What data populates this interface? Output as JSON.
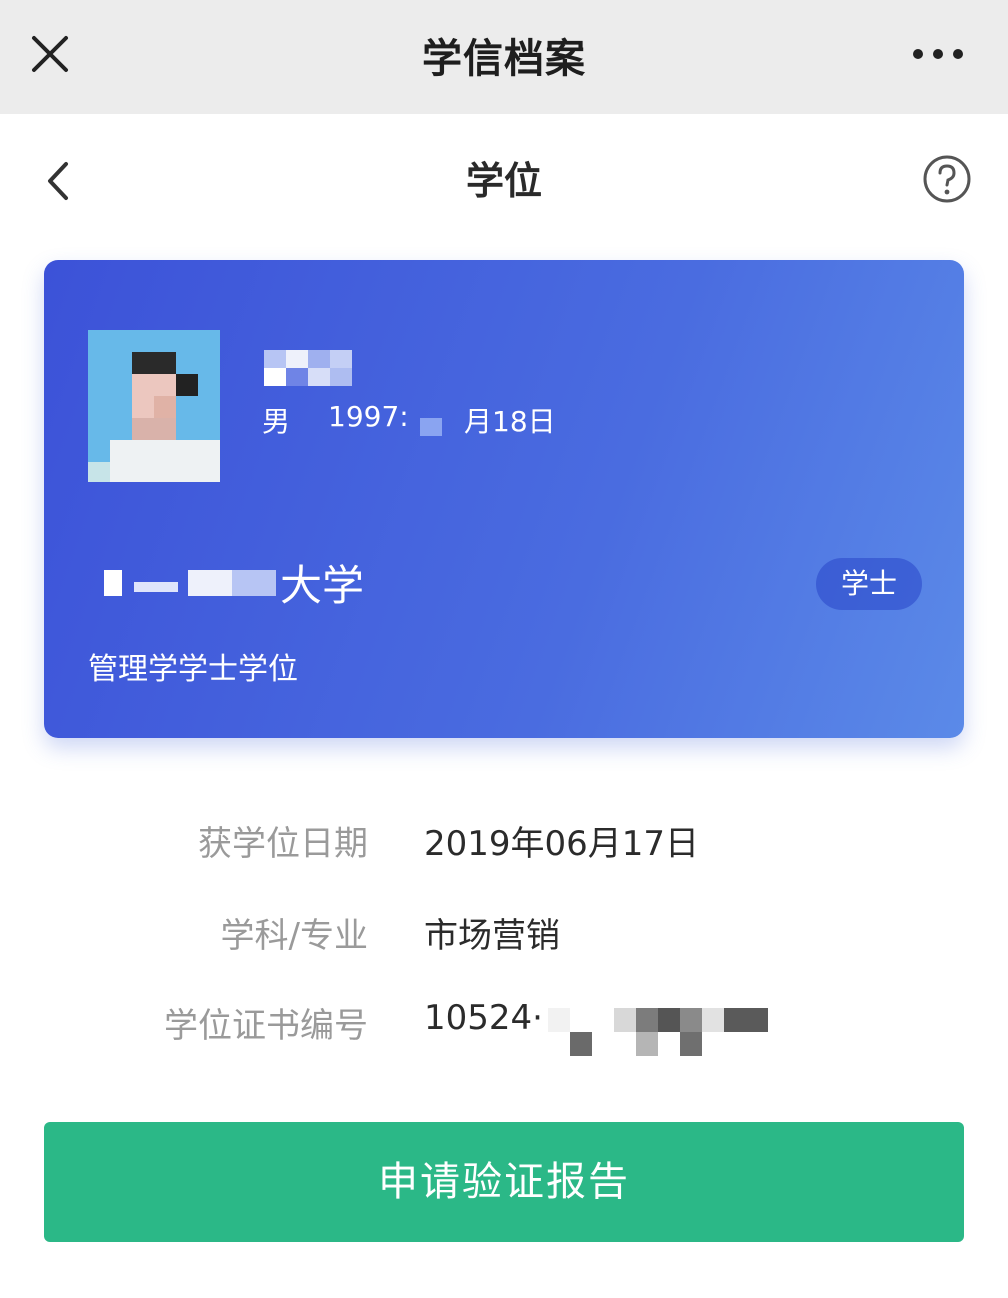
{
  "window": {
    "title": "学信档案",
    "close_icon": "close-icon",
    "more_icon": "more-dots-icon"
  },
  "navbar": {
    "title": "学位",
    "back_icon": "chevron-left-icon",
    "help_icon": "question-circle-icon"
  },
  "card": {
    "gender": "男",
    "birth_year_partial": "1997:",
    "birth_day_partial": "月18日",
    "school_suffix": "大学",
    "degree_badge": "学士",
    "degree_name": "管理学学士学位",
    "gradient_start": "#3c52d8",
    "gradient_end": "#5b8ae8"
  },
  "details": [
    {
      "label": "获学位日期",
      "value": "2019年06月17日"
    },
    {
      "label": "学科/专业",
      "value": "市场营销"
    },
    {
      "label": "学位证书编号",
      "value": "10524·"
    }
  ],
  "action": {
    "label": "申请验证报告",
    "color": "#2bb887"
  }
}
